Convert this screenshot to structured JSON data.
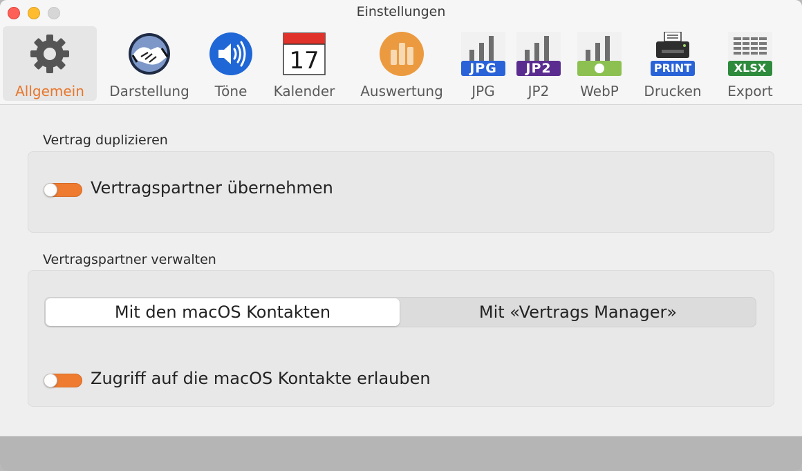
{
  "window": {
    "title": "Einstellungen"
  },
  "toolbar": {
    "items": [
      {
        "label": "Allgemein",
        "icon": "gear-icon",
        "selected": true
      },
      {
        "label": "Darstellung",
        "icon": "handshake-icon",
        "selected": false
      },
      {
        "label": "Töne",
        "icon": "speaker-icon",
        "selected": false
      },
      {
        "label": "Kalender",
        "icon": "calendar-icon",
        "selected": false,
        "badge": "17"
      },
      {
        "label": "Auswertung",
        "icon": "bar-chart-icon",
        "selected": false
      },
      {
        "label": "JPG",
        "icon": "jpg-format-icon",
        "selected": false,
        "badge": "JPG"
      },
      {
        "label": "JP2",
        "icon": "jp2-format-icon",
        "selected": false,
        "badge": "JP2"
      },
      {
        "label": "WebP",
        "icon": "webp-format-icon",
        "selected": false
      },
      {
        "label": "Drucken",
        "icon": "printer-icon",
        "selected": false,
        "badge": "PRINT"
      },
      {
        "label": "Export",
        "icon": "xlsx-export-icon",
        "selected": false,
        "badge": "XLSX"
      }
    ],
    "accent_color": "#e8762a"
  },
  "duplicate_section": {
    "title": "Vertrag duplizieren",
    "toggle_label": "Vertragspartner übernehmen"
  },
  "partner_section": {
    "title": "Vertragspartner verwalten",
    "segments": [
      "Mit den macOS Kontakten",
      "Mit «Vertrags Manager»"
    ],
    "selected_segment": "Mit den macOS Kontakten",
    "toggle_label": "Zugriff auf die macOS Kontakte erlauben"
  },
  "colors": {
    "toggle": "#ee7b30",
    "close": "#fe5f57",
    "minimize": "#febc2e"
  }
}
